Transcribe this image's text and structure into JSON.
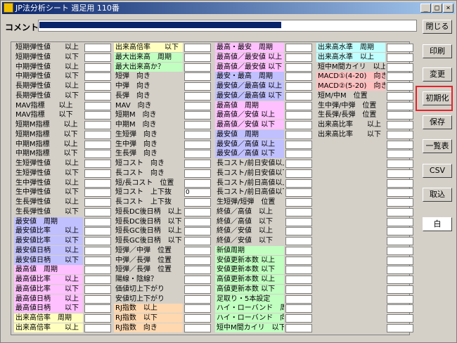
{
  "window": {
    "title": "JP法分析シート 週足用 110番"
  },
  "titlebar_buttons": [
    "_",
    "□",
    "×"
  ],
  "comment": {
    "label": "コメント",
    "value": ""
  },
  "colors": {
    "yellow": "#ffffc0",
    "green": "#c0ffc0",
    "purple": "#c0c0ff",
    "pink": "#ffc0ff",
    "orange": "#ffd8b0",
    "cyan": "#c0ffff",
    "red": "#ffc0c0",
    "gray": "#d4d0c8",
    "title_start": "#0a246a",
    "highlight": "#e8202a"
  },
  "buttons": [
    {
      "label": "閉じる"
    },
    {
      "label": "印刷"
    },
    {
      "label": "変更"
    },
    {
      "label": "初期化"
    },
    {
      "label": "保存"
    },
    {
      "label": "一覧表"
    },
    {
      "label": "CSV"
    },
    {
      "label": "取込"
    },
    {
      "label": "白"
    }
  ],
  "columns": [
    {
      "rows": [
        {
          "label": "短期弾性値　　以上",
          "color": "gray",
          "value": ""
        },
        {
          "label": "短期弾性値　　以下",
          "color": "gray",
          "value": ""
        },
        {
          "label": "中期弾性値　　以上",
          "color": "gray",
          "value": ""
        },
        {
          "label": "中期弾性値　　以下",
          "color": "gray",
          "value": ""
        },
        {
          "label": "長期弾性値　　以上",
          "color": "gray",
          "value": ""
        },
        {
          "label": "長期弾性値　　以下",
          "color": "gray",
          "value": ""
        },
        {
          "label": "MAV指標　　以上",
          "color": "gray",
          "value": ""
        },
        {
          "label": "MAV指標　　以下",
          "color": "gray",
          "value": ""
        },
        {
          "label": "短期M指標　　以上",
          "color": "gray",
          "value": ""
        },
        {
          "label": "短期M指標　　以下",
          "color": "gray",
          "value": ""
        },
        {
          "label": "中期M指標　　以上",
          "color": "gray",
          "value": ""
        },
        {
          "label": "中期M指標　　以下",
          "color": "gray",
          "value": ""
        },
        {
          "label": "生短弾性値　　以上",
          "color": "gray",
          "value": ""
        },
        {
          "label": "生短弾性値　　以下",
          "color": "gray",
          "value": ""
        },
        {
          "label": "生中弾性値　　以上",
          "color": "gray",
          "value": ""
        },
        {
          "label": "生中弾性値　　以下",
          "color": "gray",
          "value": ""
        },
        {
          "label": "生長弾性値　　以上",
          "color": "gray",
          "value": ""
        },
        {
          "label": "生長弾性値　　以下",
          "color": "gray",
          "value": ""
        },
        {
          "label": "最安値　周期",
          "color": "purple",
          "value": ""
        },
        {
          "label": "最安値比率　　以上",
          "color": "purple",
          "value": ""
        },
        {
          "label": "最安値比率　　以下",
          "color": "purple",
          "value": ""
        },
        {
          "label": "最安値日柄　　以上",
          "color": "purple",
          "value": ""
        },
        {
          "label": "最安値日柄　　以下",
          "color": "purple",
          "value": ""
        },
        {
          "label": "最高値　周期",
          "color": "pink",
          "value": ""
        },
        {
          "label": "最高値比率　　以上",
          "color": "pink",
          "value": ""
        },
        {
          "label": "最高値比率　　以下",
          "color": "pink",
          "value": ""
        },
        {
          "label": "最高値日柄　　以上",
          "color": "pink",
          "value": ""
        },
        {
          "label": "最高値日柄　　以下",
          "color": "pink",
          "value": ""
        },
        {
          "label": "出来高倍率　周期",
          "color": "yellow",
          "value": ""
        },
        {
          "label": "出来高倍率　　以上",
          "color": "yellow",
          "value": ""
        }
      ]
    },
    {
      "rows": [
        {
          "label": "出来高倍率　　以下",
          "color": "yellow",
          "value": ""
        },
        {
          "label": "最大出来高　周期",
          "color": "green",
          "value": ""
        },
        {
          "label": "最大出来高か？",
          "color": "green",
          "value": ""
        },
        {
          "label": "短弾　向き",
          "color": "gray",
          "value": ""
        },
        {
          "label": "中弾　向き",
          "color": "gray",
          "value": ""
        },
        {
          "label": "長弾　向き",
          "color": "gray",
          "value": ""
        },
        {
          "label": "MAV　向き",
          "color": "gray",
          "value": ""
        },
        {
          "label": "短期M　向き",
          "color": "gray",
          "value": ""
        },
        {
          "label": "中期M　向き",
          "color": "gray",
          "value": ""
        },
        {
          "label": "生短弾　向き",
          "color": "gray",
          "value": ""
        },
        {
          "label": "生中弾　向き",
          "color": "gray",
          "value": ""
        },
        {
          "label": "生長弾　向き",
          "color": "gray",
          "value": ""
        },
        {
          "label": "短コスト　向き",
          "color": "gray",
          "value": ""
        },
        {
          "label": "長コスト　向き",
          "color": "gray",
          "value": ""
        },
        {
          "label": "短/長コスト　位置",
          "color": "gray",
          "value": ""
        },
        {
          "label": "短コスト　上下抜",
          "color": "gray",
          "value": "0"
        },
        {
          "label": "長コスト　上下抜",
          "color": "gray",
          "value": ""
        },
        {
          "label": "短長DC後日柄　以上",
          "color": "gray",
          "value": ""
        },
        {
          "label": "短長DC後日柄　以下",
          "color": "gray",
          "value": ""
        },
        {
          "label": "短長GC後日柄　以上",
          "color": "gray",
          "value": ""
        },
        {
          "label": "短長GC後日柄　以下",
          "color": "gray",
          "value": ""
        },
        {
          "label": "短弾／中弾　位置",
          "color": "gray",
          "value": ""
        },
        {
          "label": "中弾／長弾　位置",
          "color": "gray",
          "value": ""
        },
        {
          "label": "短弾／長弾　位置",
          "color": "gray",
          "value": ""
        },
        {
          "label": "陽線・陰線？",
          "color": "gray",
          "value": ""
        },
        {
          "label": "価値切上下がり",
          "color": "gray",
          "value": ""
        },
        {
          "label": "安値切上下がり",
          "color": "gray",
          "value": ""
        },
        {
          "label": "RJ指数　以上",
          "color": "orange",
          "value": ""
        },
        {
          "label": "RJ指数　以下",
          "color": "orange",
          "value": ""
        },
        {
          "label": "RJ指数　向き",
          "color": "orange",
          "value": ""
        }
      ]
    },
    {
      "rows": [
        {
          "label": "最高・最安　周期",
          "color": "pink",
          "value": ""
        },
        {
          "label": "最高値／最安値 以上",
          "color": "pink",
          "value": ""
        },
        {
          "label": "最高値／最安値 以下",
          "color": "pink",
          "value": ""
        },
        {
          "label": "最安・最高　周期",
          "color": "purple",
          "value": ""
        },
        {
          "label": "最安値／最高値 以上",
          "color": "purple",
          "value": ""
        },
        {
          "label": "最安値／最高値 以下",
          "color": "purple",
          "value": ""
        },
        {
          "label": "最高値　周期",
          "color": "pink",
          "value": ""
        },
        {
          "label": "最高値／安値 以上",
          "color": "pink",
          "value": ""
        },
        {
          "label": "最高値／安値 以下",
          "color": "pink",
          "value": ""
        },
        {
          "label": "最安値　周期",
          "color": "purple",
          "value": ""
        },
        {
          "label": "最安値／高値 以上",
          "color": "purple",
          "value": ""
        },
        {
          "label": "最安値／高値 以下",
          "color": "purple",
          "value": ""
        },
        {
          "label": "長コスト/前日安値以上",
          "color": "gray",
          "value": ""
        },
        {
          "label": "長コスト/前日安値以下",
          "color": "gray",
          "value": ""
        },
        {
          "label": "長コスト/前日高値以上",
          "color": "gray",
          "value": ""
        },
        {
          "label": "長コスト/前日高値以下",
          "color": "gray",
          "value": ""
        },
        {
          "label": "生短弾/短弾　位置",
          "color": "gray",
          "value": ""
        },
        {
          "label": "終値／高値　以上",
          "color": "gray",
          "value": ""
        },
        {
          "label": "終値／高値　以下",
          "color": "gray",
          "value": ""
        },
        {
          "label": "終値／安値　以上",
          "color": "gray",
          "value": ""
        },
        {
          "label": "終値／安値　以下",
          "color": "gray",
          "value": ""
        },
        {
          "label": "新値周期",
          "color": "green",
          "value": ""
        },
        {
          "label": "安値更新本数 以上",
          "color": "green",
          "value": ""
        },
        {
          "label": "安値更新本数 以下",
          "color": "green",
          "value": ""
        },
        {
          "label": "高値更新本数 以上",
          "color": "green",
          "value": ""
        },
        {
          "label": "高値更新本数 以下",
          "color": "green",
          "value": ""
        },
        {
          "label": "足取り・5本設定",
          "color": "green",
          "value": ""
        },
        {
          "label": "ハイ・ローバンド　周期",
          "color": "green",
          "value": ""
        },
        {
          "label": "ハイ・ローバンド　向き",
          "color": "green",
          "value": ""
        },
        {
          "label": "短中M間カイリ　以下",
          "color": "green",
          "value": ""
        }
      ]
    },
    {
      "rows": [
        {
          "label": "出来高水準　周期",
          "color": "cyan",
          "value": ""
        },
        {
          "label": "出来高水準　以上",
          "color": "cyan",
          "value": ""
        },
        {
          "label": "短中M間カイリ　以上",
          "color": "gray",
          "value": ""
        },
        {
          "label": "MACD①(4-20)　向き",
          "color": "red",
          "value": ""
        },
        {
          "label": "MACD②(5-20)　向き",
          "color": "red",
          "value": ""
        },
        {
          "label": "短M/中M　位置",
          "color": "gray",
          "value": ""
        },
        {
          "label": "生中弾/中弾　位置",
          "color": "gray",
          "value": ""
        },
        {
          "label": "生長弾/長弾　位置",
          "color": "gray",
          "value": ""
        },
        {
          "label": "出来高比率　　以上",
          "color": "gray",
          "value": ""
        },
        {
          "label": "出来高比率　　以下",
          "color": "gray",
          "value": ""
        },
        {
          "label": "",
          "color": "gray",
          "value": ""
        },
        {
          "label": "",
          "color": "gray",
          "value": ""
        },
        {
          "label": "",
          "color": "gray",
          "value": ""
        },
        {
          "label": "",
          "color": "gray",
          "value": ""
        },
        {
          "label": "",
          "color": "gray",
          "value": ""
        },
        {
          "label": "",
          "color": "gray",
          "value": ""
        },
        {
          "label": "",
          "color": "gray",
          "value": ""
        },
        {
          "label": "",
          "color": "gray",
          "value": ""
        },
        {
          "label": "",
          "color": "gray",
          "value": ""
        },
        {
          "label": "",
          "color": "gray",
          "value": ""
        },
        {
          "label": "",
          "color": "gray",
          "value": ""
        },
        {
          "label": "",
          "color": "gray",
          "value": ""
        },
        {
          "label": "",
          "color": "gray",
          "value": ""
        },
        {
          "label": "",
          "color": "gray",
          "value": ""
        },
        {
          "label": "",
          "color": "gray",
          "value": ""
        },
        {
          "label": "",
          "color": "gray",
          "value": ""
        },
        {
          "label": "",
          "color": "gray",
          "value": ""
        },
        {
          "label": "",
          "color": "gray",
          "value": ""
        },
        {
          "label": "",
          "color": "gray",
          "value": ""
        },
        {
          "label": "",
          "color": "gray",
          "value": ""
        }
      ]
    }
  ]
}
